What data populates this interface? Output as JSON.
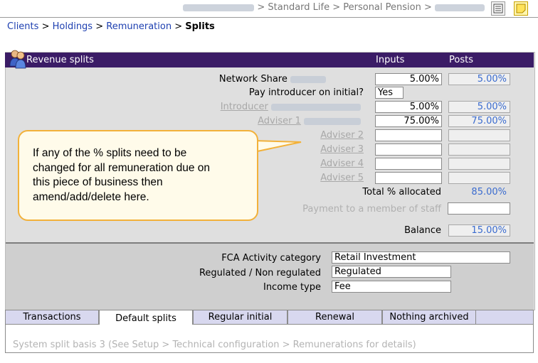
{
  "topbar": {
    "path_rest": "> Standard Life > Personal Pension >"
  },
  "breadcrumb": {
    "clients": "Clients",
    "sep": ">",
    "holdings": "Holdings",
    "remuneration": "Remuneration",
    "current": "Splits"
  },
  "panel": {
    "title": "Revenue splits",
    "col_inputs": "Inputs",
    "col_posts": "Posts",
    "rows": {
      "network_share": {
        "label": "Network Share",
        "input": "5.00%",
        "post": "5.00%"
      },
      "pay_introducer": {
        "label": "Pay introducer on initial?",
        "value": "Yes"
      },
      "introducer": {
        "label": "Introducer",
        "input": "5.00%",
        "post": "5.00%"
      },
      "adviser1": {
        "label": "Adviser 1",
        "input": "75.00%",
        "post": "75.00%"
      },
      "adviser2": {
        "label": "Adviser 2"
      },
      "adviser3": {
        "label": "Adviser 3"
      },
      "adviser4": {
        "label": "Adviser 4"
      },
      "adviser5": {
        "label": "Adviser 5"
      },
      "total": {
        "label": "Total % allocated",
        "post": "85.00%"
      },
      "staff_payment": {
        "label": "Payment to a member of staff"
      },
      "balance": {
        "label": "Balance",
        "post": "15.00%"
      }
    },
    "fca_label": "FCA Activity category",
    "fca_value": "Retail Investment",
    "regulated_label": "Regulated / Non regulated",
    "regulated_value": "Regulated",
    "income_label": "Income type",
    "income_value": "Fee"
  },
  "callout": {
    "text_lines": [
      "If any of the % splits need to be",
      "changed for all remuneration due on",
      "this piece of business then",
      "amend/add/delete here."
    ]
  },
  "tabs": [
    "Transactions",
    "Default splits",
    "Regular initial",
    "Renewal",
    "Nothing archived"
  ],
  "footer": "System split basis 3 (See Setup > Technical configuration > Remunerations for details)",
  "icons": {
    "panel": "people-icon",
    "topbar_1": "list-icon",
    "topbar_2": "note-icon"
  },
  "colors": {
    "header_bg": "#3b1c66",
    "link": "#1d3fb0",
    "post_value": "#3b6ccf",
    "callout_border": "#f2b13a"
  }
}
